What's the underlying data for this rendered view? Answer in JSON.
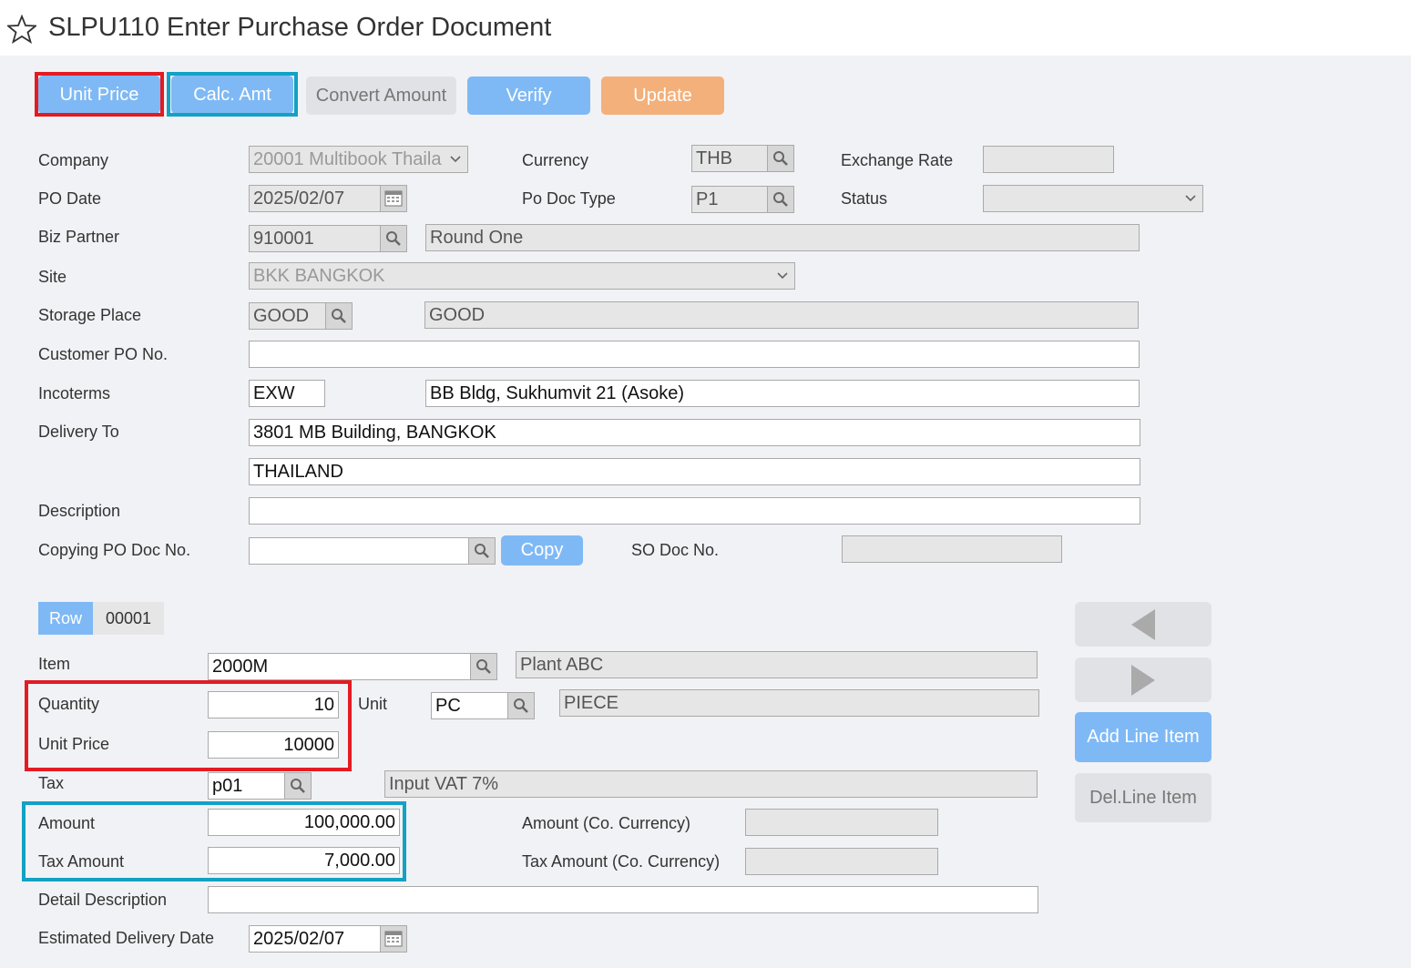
{
  "header": {
    "title": "SLPU110 Enter Purchase Order Document",
    "icon": "star-outline"
  },
  "toolbar": {
    "unit_price": "Unit Price",
    "calc_amt": "Calc. Amt",
    "convert_amount": "Convert Amount",
    "verify": "Verify",
    "update": "Update"
  },
  "form": {
    "company": {
      "label": "Company",
      "value": "20001 Multibook Thaila"
    },
    "currency": {
      "label": "Currency",
      "value": "THB"
    },
    "exchange_rate": {
      "label": "Exchange Rate",
      "value": ""
    },
    "po_date": {
      "label": "PO Date",
      "value": "2025/02/07"
    },
    "po_doc_type": {
      "label": "Po Doc Type",
      "value": "P1"
    },
    "status": {
      "label": "Status",
      "value": ""
    },
    "biz_partner": {
      "label": "Biz Partner",
      "code": "910001",
      "name": "Round One"
    },
    "site": {
      "label": "Site",
      "value": "BKK BANGKOK"
    },
    "storage_place": {
      "label": "Storage Place",
      "code": "GOOD",
      "name": "GOOD"
    },
    "customer_po_no": {
      "label": "Customer PO No.",
      "value": ""
    },
    "incoterms": {
      "label": "Incoterms",
      "code": "EXW",
      "desc": "BB Bldg, Sukhumvit 21 (Asoke)"
    },
    "delivery_to": {
      "label": "Delivery To",
      "line1": "3801 MB Building, BANGKOK",
      "line2": "THAILAND"
    },
    "description": {
      "label": "Description",
      "value": ""
    },
    "copying_po_doc_no": {
      "label": "Copying PO Doc No.",
      "value": "",
      "copy_button": "Copy"
    },
    "so_doc_no": {
      "label": "SO Doc No.",
      "value": ""
    }
  },
  "detail": {
    "row_label": "Row",
    "row_number": "00001",
    "item": {
      "label": "Item",
      "code": "2000M",
      "name": "Plant ABC"
    },
    "quantity": {
      "label": "Quantity",
      "value": "10"
    },
    "unit": {
      "label": "Unit",
      "code": "PC",
      "name": "PIECE"
    },
    "unit_price": {
      "label": "Unit Price",
      "value": "10000"
    },
    "tax": {
      "label": "Tax",
      "code": "p01",
      "name": "Input VAT 7%"
    },
    "amount": {
      "label": "Amount",
      "value": "100,000.00"
    },
    "amount_co": {
      "label": "Amount (Co. Currency)",
      "value": ""
    },
    "tax_amount": {
      "label": "Tax Amount",
      "value": "7,000.00"
    },
    "tax_amount_co": {
      "label": "Tax Amount (Co. Currency)",
      "value": ""
    },
    "detail_description": {
      "label": "Detail Description",
      "value": ""
    },
    "estimated_delivery_date": {
      "label": "Estimated Delivery Date",
      "value": "2025/02/07"
    }
  },
  "side": {
    "add_line_item": "Add Line Item",
    "del_line_item": "Del.Line Item"
  },
  "colors": {
    "primary": "#7fb9f5",
    "accent": "#f3b07a",
    "highlight_red": "#e31b23",
    "highlight_teal": "#13a1c5"
  }
}
